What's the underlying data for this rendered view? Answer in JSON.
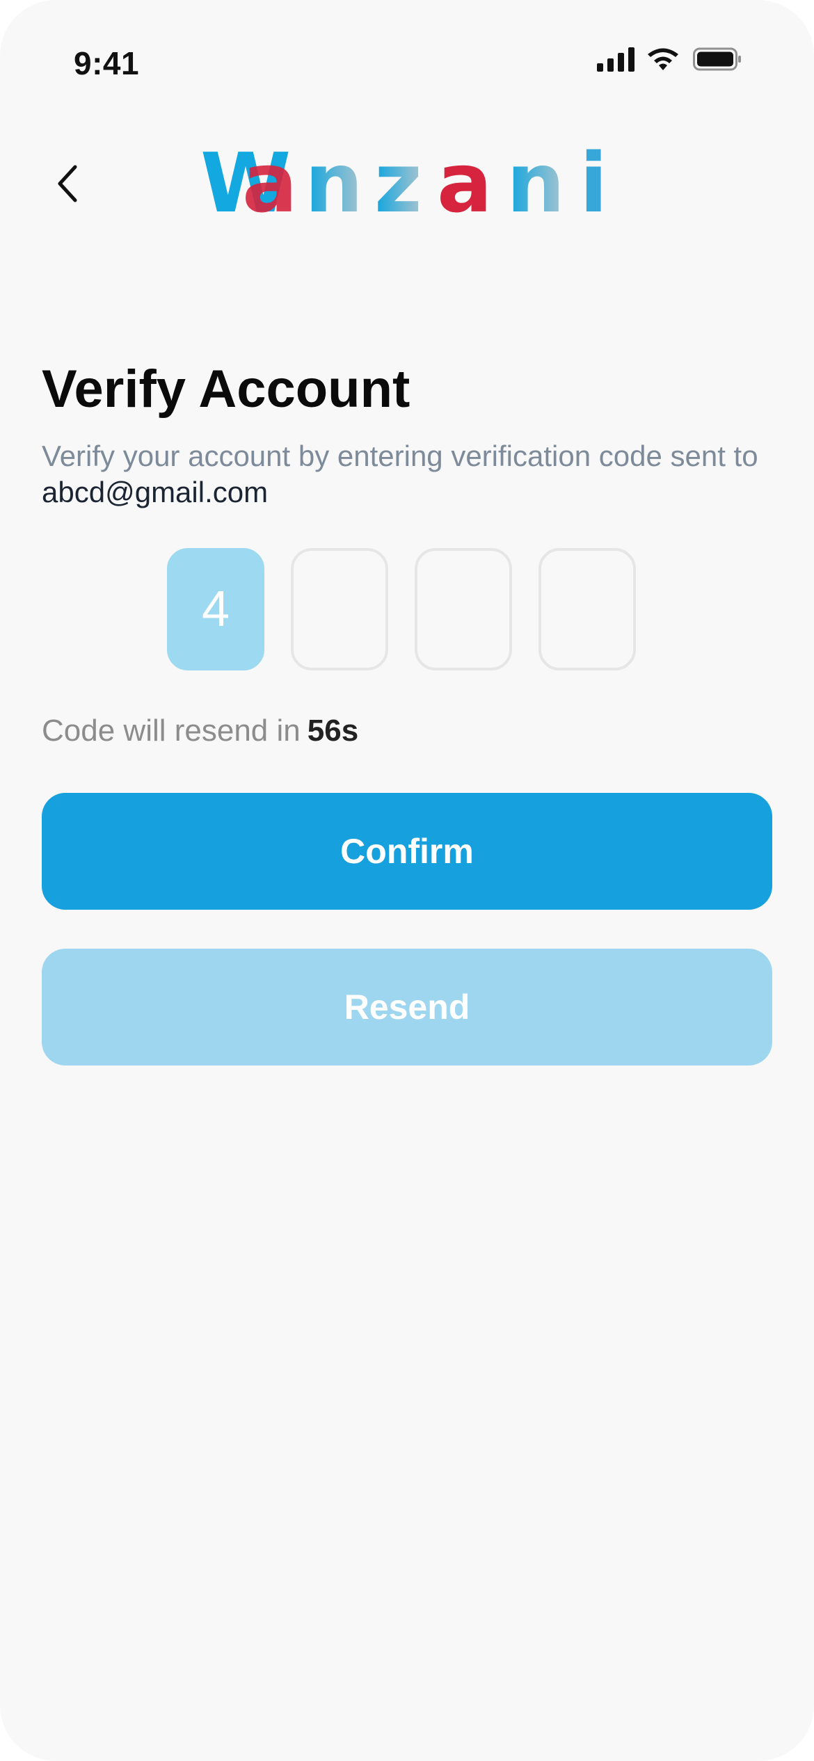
{
  "status_bar": {
    "time": "9:41"
  },
  "header": {
    "logo_text": "Wanzani",
    "back_icon": "chevron-left-icon"
  },
  "main": {
    "title": "Verify Account",
    "subtitle_prefix": "Verify your account by entering verification code sent to",
    "email": "abcd@gmail.com",
    "code_digits": [
      "4",
      "",
      "",
      ""
    ],
    "resend_note_label": "Code will resend in",
    "resend_countdown": "56s",
    "confirm_label": "Confirm",
    "resend_label": "Resend"
  },
  "colors": {
    "primary": "#16a0dd",
    "primary_light": "#9fd6ef",
    "otp_filled": "#9ddaf1",
    "logo_red": "#d6243f",
    "background": "#f8f8f8"
  }
}
